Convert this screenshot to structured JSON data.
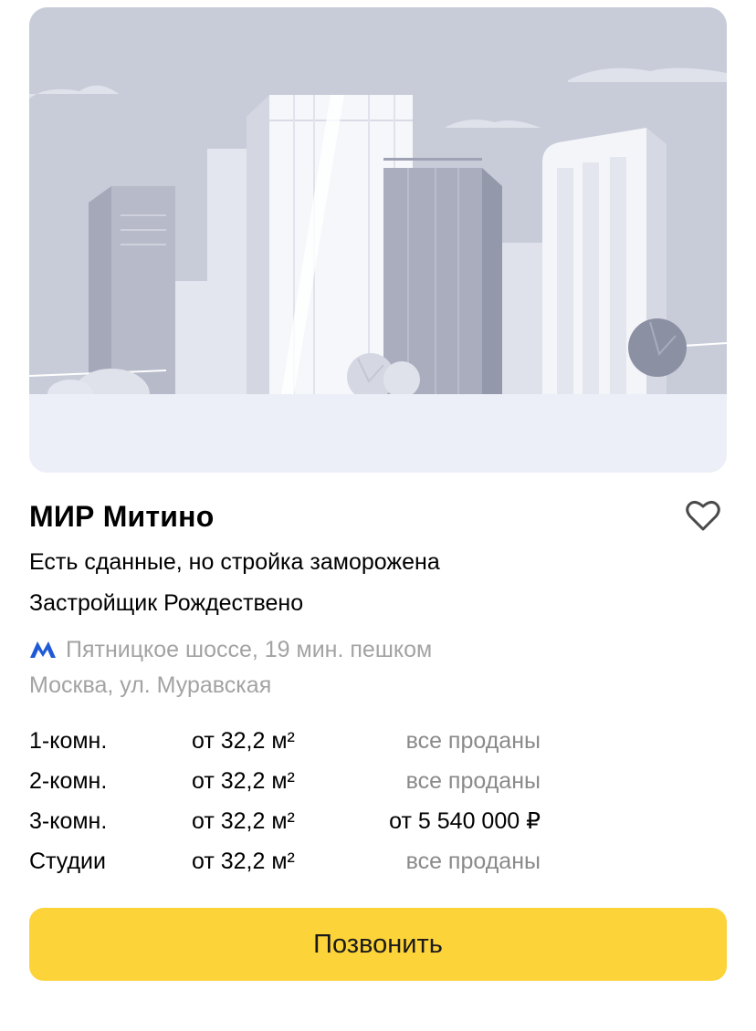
{
  "complex": {
    "name": "МИР Митино",
    "status": "Есть сданные, но стройка заморожена",
    "developer": "Застройщик Рождествено"
  },
  "location": {
    "metro_icon": "metro-icon",
    "metro_color": "#1e5ad7",
    "metro": "Пятницкое шоссе, 19 мин. пешком",
    "address": "Москва, ул. Муравская"
  },
  "offers": [
    {
      "rooms": "1-комн.",
      "area": "от 32,2 м²",
      "price": "все проданы",
      "sold": true
    },
    {
      "rooms": "2-комн.",
      "area": "от 32,2 м²",
      "price": "все проданы",
      "sold": true
    },
    {
      "rooms": "3-комн.",
      "area": "от 32,2 м²",
      "price": "от 5 540 000 ₽",
      "sold": false
    },
    {
      "rooms": "Студии",
      "area": "от 32,2 м²",
      "price": "все проданы",
      "sold": true
    }
  ],
  "actions": {
    "call_label": "Позвонить",
    "call_color": "#fdd33a",
    "favorite_icon": "heart-outline-icon"
  },
  "image": {
    "placeholder_icon": "city-skyline-illustration"
  }
}
